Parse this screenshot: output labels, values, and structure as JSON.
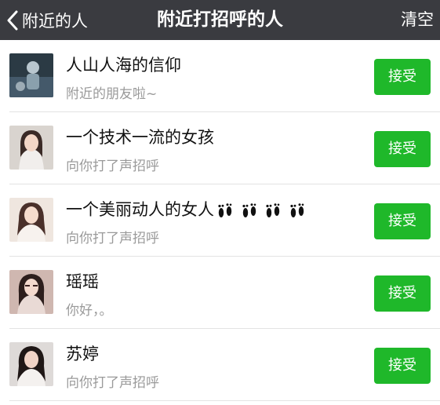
{
  "header": {
    "back_label": "附近的人",
    "title": "附近打招呼的人",
    "clear_label": "清空"
  },
  "requests": [
    {
      "name": "人山人海的信仰",
      "message": "附近的朋友啦~",
      "accept_label": "接受",
      "avatar": "avatar-dark-photo"
    },
    {
      "name": "一个技术一流的女孩",
      "message": "向你打了声招呼",
      "accept_label": "接受",
      "avatar": "avatar-girl-photo"
    },
    {
      "name": "一个美丽动人的女人",
      "message": "向你打了声招呼",
      "accept_label": "接受",
      "avatar": "avatar-woman-photo",
      "name_emoji": "footprints-icon x4"
    },
    {
      "name": "瑶瑶",
      "message": "你好，。",
      "accept_label": "接受",
      "avatar": "avatar-girl-photo"
    },
    {
      "name": "苏婷",
      "message": "向你打了声招呼",
      "accept_label": "接受",
      "avatar": "avatar-girl-photo"
    }
  ],
  "colors": {
    "navbar_bg": "#3a3b40",
    "accept_green": "#1fb82a",
    "secondary_text": "#9a9a9a"
  }
}
